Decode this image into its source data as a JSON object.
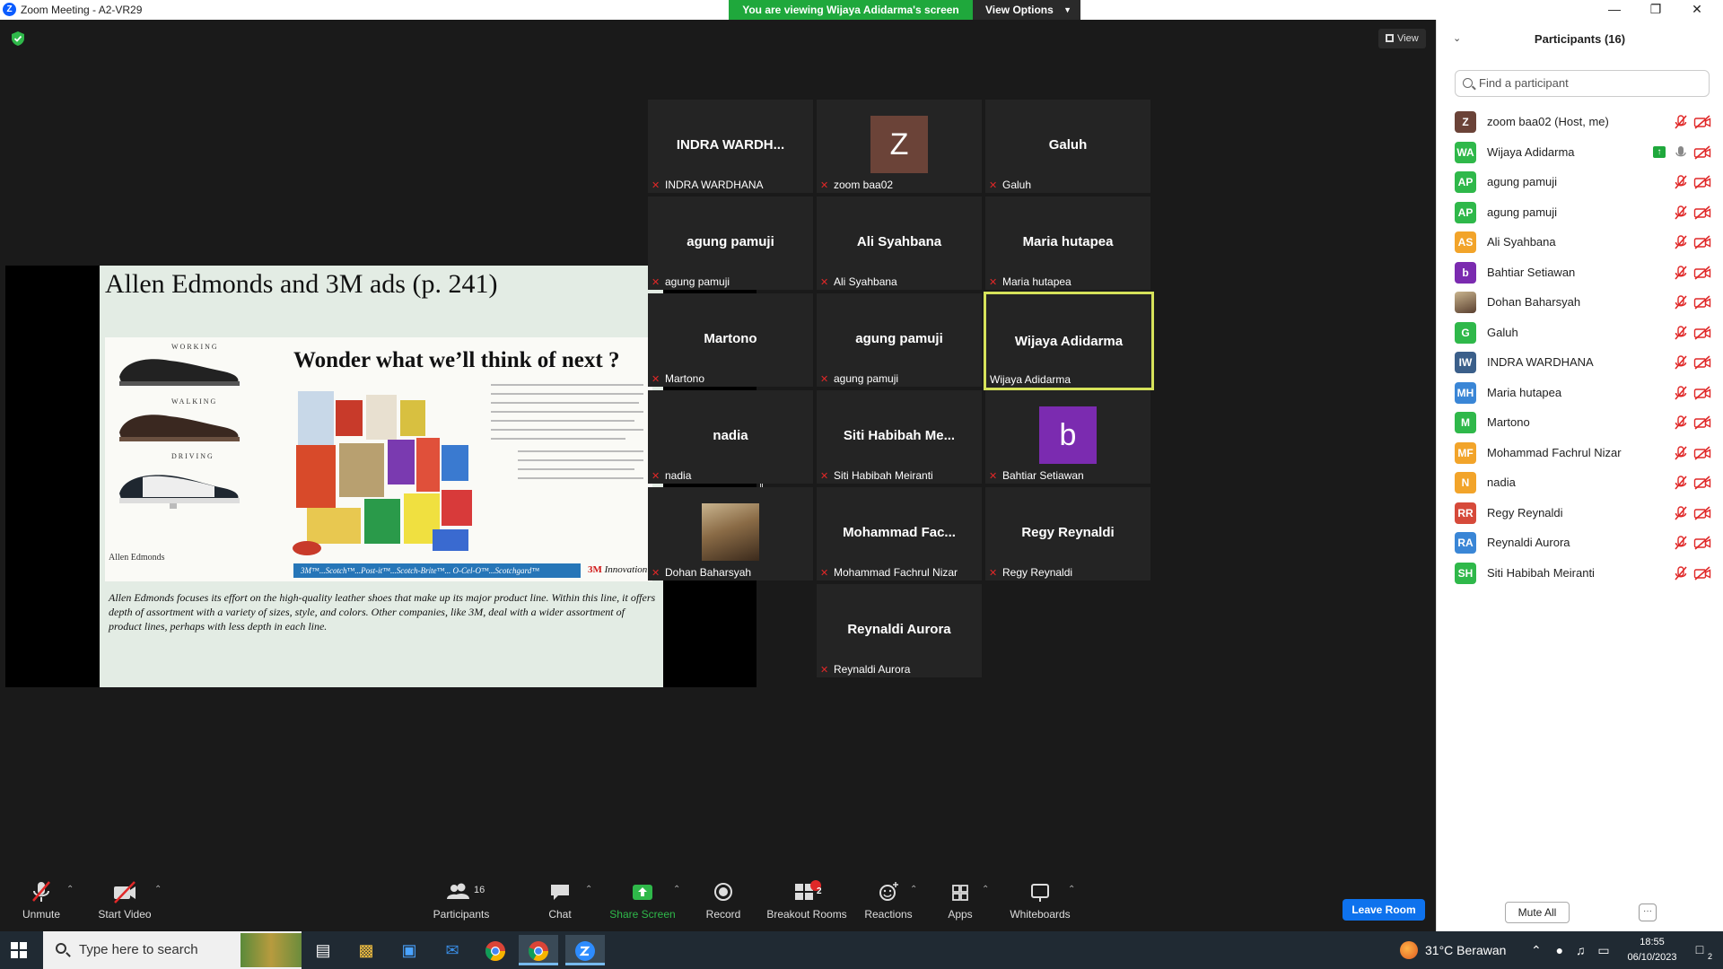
{
  "window": {
    "title": "Zoom Meeting - A2-VR29",
    "logo_glyph": "Z",
    "share_banner": "You are viewing Wijaya Adidarma's screen",
    "view_options": "View Options"
  },
  "meeting": {
    "view_label": "View"
  },
  "slide": {
    "title": "Allen Edmonds  and 3M ads (p. 241)",
    "ad_headline": "Wonder what we’ll think of next ?",
    "shoe_labels": [
      "WORKING",
      "WALKING",
      "DRIVING"
    ],
    "ad_footer": "3M™...Scotch™...Post-it™...Scotch-Brite™... O-Cel-O™...Scotchgard™",
    "ad_brand": "3M",
    "ad_tagline": "Innovation",
    "allen_logo": "Allen Edmonds",
    "caption": "Allen Edmonds focuses its effort on the high-quality leather shoes that make up its major product line. Within this line, it offers depth of assortment with a variety of sizes, style, and colors. Other companies, like 3M, deal with a wider assortment of product lines, perhaps with less depth in each line."
  },
  "gallery": [
    {
      "center": "INDRA  WARDH...",
      "tag": "INDRA WARDHANA",
      "muted": true
    },
    {
      "avatar": "Z",
      "avatar_color": "#6b4338",
      "tag": "zoom baa02",
      "muted": true
    },
    {
      "center": "Galuh",
      "tag": "Galuh",
      "muted": true
    },
    {
      "center": "agung pamuji",
      "tag": "agung pamuji",
      "muted": true
    },
    {
      "center": "Ali Syahbana",
      "tag": "Ali Syahbana",
      "muted": true
    },
    {
      "center": "Maria hutapea",
      "tag": "Maria hutapea",
      "muted": true
    },
    {
      "center": "Martono",
      "tag": "Martono",
      "muted": true
    },
    {
      "center": "agung pamuji",
      "tag": "agung pamuji",
      "muted": true
    },
    {
      "center": "Wijaya Adidarma",
      "tag": "Wijaya Adidarma",
      "muted": false,
      "active": true
    },
    {
      "center": "nadia",
      "tag": "nadia",
      "muted": true
    },
    {
      "center": "Siti  Habibah Me...",
      "tag": "Siti Habibah Meiranti",
      "muted": true
    },
    {
      "avatar": "b",
      "avatar_color": "#7b2bb0",
      "tag": "Bahtiar Setiawan",
      "muted": true
    },
    {
      "photo": true,
      "tag": "Dohan Baharsyah",
      "muted": true
    },
    {
      "center": "Mohammad  Fac...",
      "tag": "Mohammad Fachrul Nizar",
      "muted": true
    },
    {
      "center": "Regy Reynaldi",
      "tag": "Regy Reynaldi",
      "muted": true
    },
    {
      "center": "Reynaldi Aurora",
      "tag": "Reynaldi Aurora",
      "muted": true
    }
  ],
  "toolbar": {
    "unmute": "Unmute",
    "start_video": "Start Video",
    "participants": "Participants",
    "participants_count": "16",
    "chat": "Chat",
    "share_screen": "Share Screen",
    "record": "Record",
    "breakout_rooms": "Breakout Rooms",
    "breakout_badge": "2",
    "reactions": "Reactions",
    "apps": "Apps",
    "whiteboards": "Whiteboards",
    "leave_room": "Leave Room"
  },
  "panel": {
    "title": "Participants (16)",
    "search_placeholder": "Find a participant",
    "participants": [
      {
        "initials": "Z",
        "color": "#6b4338",
        "name": "zoom baa02 (Host, me)"
      },
      {
        "initials": "WA",
        "color": "#2fb84a",
        "name": "Wijaya Adidarma",
        "sharing": true
      },
      {
        "initials": "AP",
        "color": "#2fb84a",
        "name": "agung pamuji"
      },
      {
        "initials": "AP",
        "color": "#2fb84a",
        "name": "agung pamuji"
      },
      {
        "initials": "AS",
        "color": "#f2a42a",
        "name": "Ali Syahbana"
      },
      {
        "initials": "b",
        "color": "#7b2bb0",
        "name": "Bahtiar Setiawan"
      },
      {
        "initials": "",
        "color": "#8a6b46",
        "name": "Dohan Baharsyah",
        "photo": true
      },
      {
        "initials": "G",
        "color": "#2fb84a",
        "name": "Galuh"
      },
      {
        "initials": "IW",
        "color": "#3b5f8a",
        "name": "INDRA WARDHANA"
      },
      {
        "initials": "MH",
        "color": "#3a86d6",
        "name": "Maria hutapea"
      },
      {
        "initials": "M",
        "color": "#2fb84a",
        "name": "Martono"
      },
      {
        "initials": "MF",
        "color": "#f2a42a",
        "name": "Mohammad Fachrul Nizar"
      },
      {
        "initials": "N",
        "color": "#f2a42a",
        "name": "nadia"
      },
      {
        "initials": "RR",
        "color": "#d64a3a",
        "name": "Regy Reynaldi"
      },
      {
        "initials": "RA",
        "color": "#3a86d6",
        "name": "Reynaldi Aurora"
      },
      {
        "initials": "SH",
        "color": "#2fb84a",
        "name": "Siti Habibah Meiranti"
      }
    ],
    "mute_all": "Mute All",
    "more": "···"
  },
  "taskbar": {
    "search_placeholder": "Type here to search",
    "weather": "31°C  Berawan",
    "time": "18:55",
    "date": "06/10/2023",
    "notifications": "2",
    "apps": [
      "task-view-icon",
      "file-explorer-icon",
      "store-icon",
      "mail-icon",
      "chrome-icon",
      "chrome-profile-icon",
      "zoom-icon"
    ]
  }
}
